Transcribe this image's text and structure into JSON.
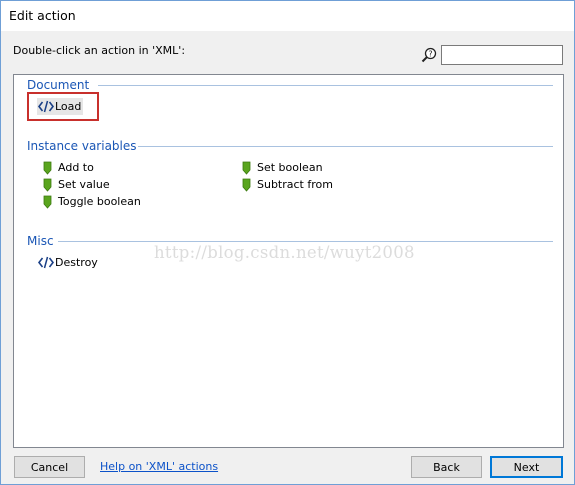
{
  "window": {
    "title": "Edit action"
  },
  "prompt": "Double-click an action in 'XML':",
  "search": {
    "value": "",
    "placeholder": ""
  },
  "categories": [
    {
      "name": "Document",
      "actions": [
        {
          "label": "Load",
          "icon": "xml-code-icon",
          "selected": true
        }
      ]
    },
    {
      "name": "Instance variables",
      "actions": [
        {
          "label": "Add to",
          "icon": "green-flag-icon"
        },
        {
          "label": "Set value",
          "icon": "green-flag-icon"
        },
        {
          "label": "Toggle boolean",
          "icon": "green-flag-icon"
        },
        {
          "label": "Set boolean",
          "icon": "green-flag-icon"
        },
        {
          "label": "Subtract from",
          "icon": "green-flag-icon"
        }
      ]
    },
    {
      "name": "Misc",
      "actions": [
        {
          "label": "Destroy",
          "icon": "xml-code-icon"
        }
      ]
    }
  ],
  "watermark": "http://blog.csdn.net/wuyt2008",
  "buttons": {
    "cancel": "Cancel",
    "help": "Help on 'XML' actions",
    "back": "Back",
    "next": "Next"
  },
  "colors": {
    "accent": "#1a56b5",
    "selection_outline": "#c8302c",
    "flag": "#5aa51e"
  }
}
